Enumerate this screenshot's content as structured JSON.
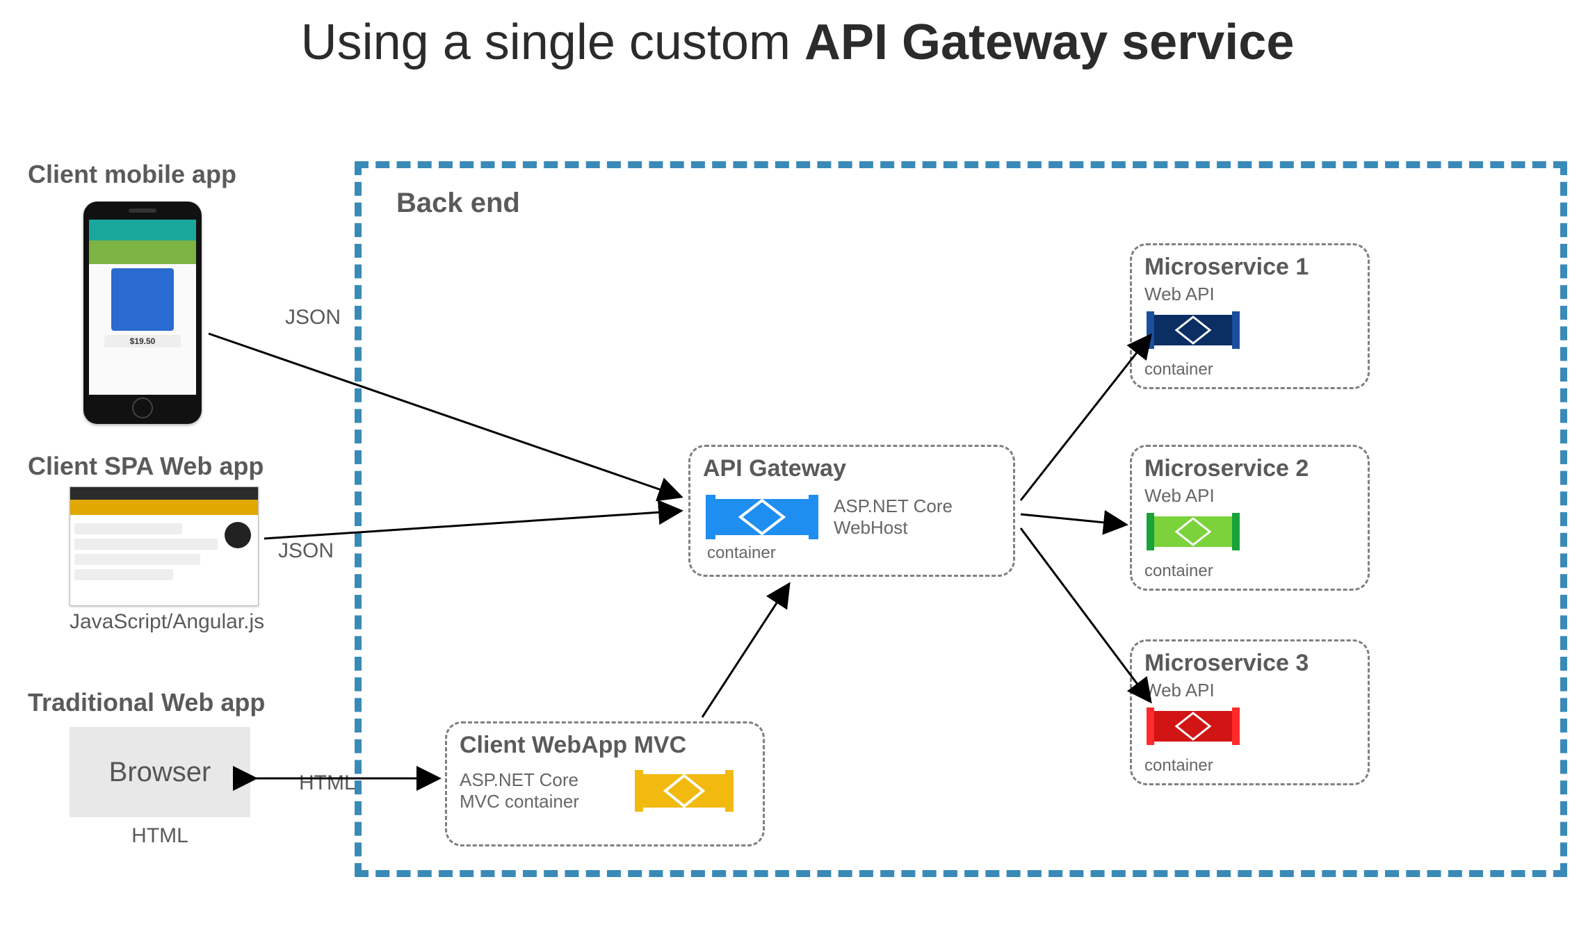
{
  "title_prefix": "Using a single custom ",
  "title_bold": "API Gateway service",
  "backend_label": "Back end",
  "clients": {
    "mobile": {
      "label": "Client mobile app",
      "price": "$19.50",
      "arrow_label": "JSON"
    },
    "spa": {
      "label": "Client SPA Web app",
      "sub": "JavaScript/Angular.js",
      "arrow_label": "JSON"
    },
    "traditional": {
      "label": "Traditional Web app",
      "box": "Browser",
      "sub": "HTML",
      "arrow_label": "HTML"
    }
  },
  "gateway": {
    "title": "API Gateway",
    "sub": "ASP.NET Core WebHost",
    "caption": "container",
    "color": "#1f8ef1"
  },
  "mvc": {
    "title": "Client WebApp MVC",
    "sub": "ASP.NET Core MVC container",
    "color": "#f2b90f"
  },
  "microservices": [
    {
      "title": "Microservice 1",
      "sub": "Web API",
      "caption": "container",
      "color": "#0b2e63",
      "accent": "#1b4f9c"
    },
    {
      "title": "Microservice 2",
      "sub": "Web API",
      "caption": "container",
      "color": "#19a23a",
      "accent": "#7bd23b"
    },
    {
      "title": "Microservice 3",
      "sub": "Web API",
      "caption": "container",
      "color": "#d11515",
      "accent": "#ff2a2a"
    }
  ]
}
